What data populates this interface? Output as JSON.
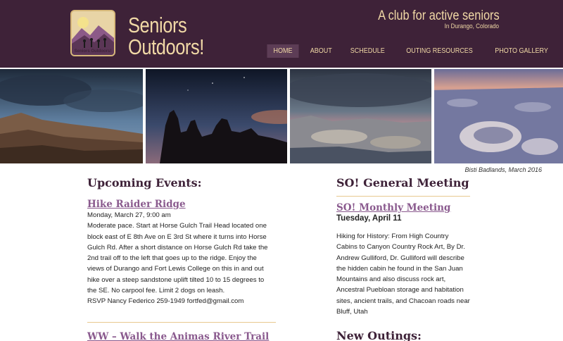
{
  "header": {
    "site_title_line1": "Seniors",
    "site_title_line2": "Outdoors!",
    "logo_text": "Seniors Outdoors!",
    "tagline": "A club for active seniors",
    "location": "In Durango, Colorado"
  },
  "nav": {
    "items": [
      {
        "label": "Home",
        "active": true
      },
      {
        "label": "About",
        "active": false
      },
      {
        "label": "Schedule",
        "active": false
      },
      {
        "label": "Outing Resources",
        "active": false
      },
      {
        "label": "Photo Gallery",
        "active": false
      }
    ]
  },
  "gallery": {
    "caption": "Bisti Badlands, March 2016"
  },
  "upcoming": {
    "heading": "Upcoming Events:",
    "event1": {
      "title": "Hike Raider Ridge",
      "datetime": "Monday, March 27, 9:00 am",
      "line1": "Moderate pace. Start at Horse Gulch Trail Head located one",
      "line2": "block east of E 8th Ave on E 3rd St where it turns into Horse",
      "line3": "Gulch Rd. After a short distance on Horse Gulch Rd take the",
      "line4": "2nd trail off to the left that goes up to the ridge. Enjoy the",
      "line5": "views of Durango and Fort Lewis College on this in and out",
      "line6": "hike over a steep sandstone uplift tilted 10 to 15 degrees to",
      "line7": "the SE. No carpool fee. Limit 2 dogs on leash.",
      "rsvp": "RSVP Nancy Federico 259-1949 fortfed@gmail.com"
    },
    "event2": {
      "title": "WW – Walk the Animas River Trail"
    }
  },
  "meeting": {
    "heading": "SO! General Meeting",
    "title": "SO! Monthly Meeting",
    "date": "Tuesday, April 11",
    "line1": "Hiking for History: From High Country",
    "line2": "Cabins to Canyon Country Rock Art, By Dr.",
    "line3": "Andrew Gulliford, Dr. Gulliford will describe",
    "line4": "the hidden cabin he found in the San Juan",
    "line5": "Mountains and also discuss rock art,",
    "line6": "Ancestral Puebloan storage and habitation",
    "line7": "sites, ancient trails, and Chacoan roads near",
    "line8": "Bluff, Utah"
  },
  "outings": {
    "heading": "New Outings:"
  },
  "colors": {
    "header_bg": "#3e2238",
    "accent_text": "#f1d9a6",
    "link": "#8a5a8e",
    "divider": "#e8c98f"
  }
}
